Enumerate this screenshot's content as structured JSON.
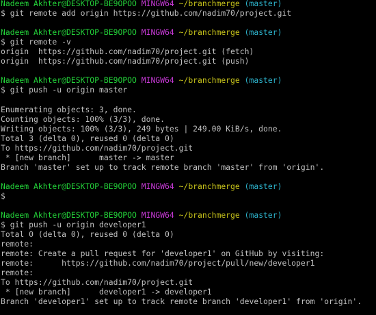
{
  "terminal": {
    "colors": {
      "background": "#000000",
      "text": "#c0c0c0",
      "user_host": "#23d139",
      "shell": "#c83ad7",
      "path": "#c8c41b",
      "branch": "#2eb6cf"
    },
    "lines": [
      {
        "type": "prompt",
        "user": "Nadeem Akhter@DESKTOP-BE9OPOO",
        "shell": "MINGW64",
        "path": "~/branchmerge",
        "branch": "(master)"
      },
      {
        "type": "command",
        "text": "$ git remote add origin https://github.com/nadim70/project.git"
      },
      {
        "type": "blank",
        "text": ""
      },
      {
        "type": "prompt",
        "user": "Nadeem Akhter@DESKTOP-BE9OPOO",
        "shell": "MINGW64",
        "path": "~/branchmerge",
        "branch": "(master)"
      },
      {
        "type": "command",
        "text": "$ git remote -v"
      },
      {
        "type": "output",
        "text": "origin  https://github.com/nadim70/project.git (fetch)"
      },
      {
        "type": "output",
        "text": "origin  https://github.com/nadim70/project.git (push)"
      },
      {
        "type": "blank",
        "text": ""
      },
      {
        "type": "prompt",
        "user": "Nadeem Akhter@DESKTOP-BE9OPOO",
        "shell": "MINGW64",
        "path": "~/branchmerge",
        "branch": "(master)"
      },
      {
        "type": "command",
        "text": "$ git push -u origin master"
      },
      {
        "type": "blank",
        "text": ""
      },
      {
        "type": "output",
        "text": "Enumerating objects: 3, done."
      },
      {
        "type": "output",
        "text": "Counting objects: 100% (3/3), done."
      },
      {
        "type": "output",
        "text": "Writing objects: 100% (3/3), 249 bytes | 249.00 KiB/s, done."
      },
      {
        "type": "output",
        "text": "Total 3 (delta 0), reused 0 (delta 0)"
      },
      {
        "type": "output",
        "text": "To https://github.com/nadim70/project.git"
      },
      {
        "type": "output",
        "text": " * [new branch]      master -> master"
      },
      {
        "type": "output",
        "text": "Branch 'master' set up to track remote branch 'master' from 'origin'."
      },
      {
        "type": "blank",
        "text": ""
      },
      {
        "type": "prompt",
        "user": "Nadeem Akhter@DESKTOP-BE9OPOO",
        "shell": "MINGW64",
        "path": "~/branchmerge",
        "branch": "(master)"
      },
      {
        "type": "command",
        "text": "$"
      },
      {
        "type": "blank",
        "text": ""
      },
      {
        "type": "prompt",
        "user": "Nadeem Akhter@DESKTOP-BE9OPOO",
        "shell": "MINGW64",
        "path": "~/branchmerge",
        "branch": "(master)"
      },
      {
        "type": "command",
        "text": "$ git push -u origin developer1"
      },
      {
        "type": "output",
        "text": "Total 0 (delta 0), reused 0 (delta 0)"
      },
      {
        "type": "output",
        "text": "remote:"
      },
      {
        "type": "output",
        "text": "remote: Create a pull request for 'developer1' on GitHub by visiting:"
      },
      {
        "type": "output",
        "text": "remote:      https://github.com/nadim70/project/pull/new/developer1"
      },
      {
        "type": "output",
        "text": "remote:"
      },
      {
        "type": "output",
        "text": "To https://github.com/nadim70/project.git"
      },
      {
        "type": "output",
        "text": " * [new branch]      developer1 -> developer1"
      },
      {
        "type": "output",
        "text": "Branch 'developer1' set up to track remote branch 'developer1' from 'origin'."
      }
    ]
  }
}
